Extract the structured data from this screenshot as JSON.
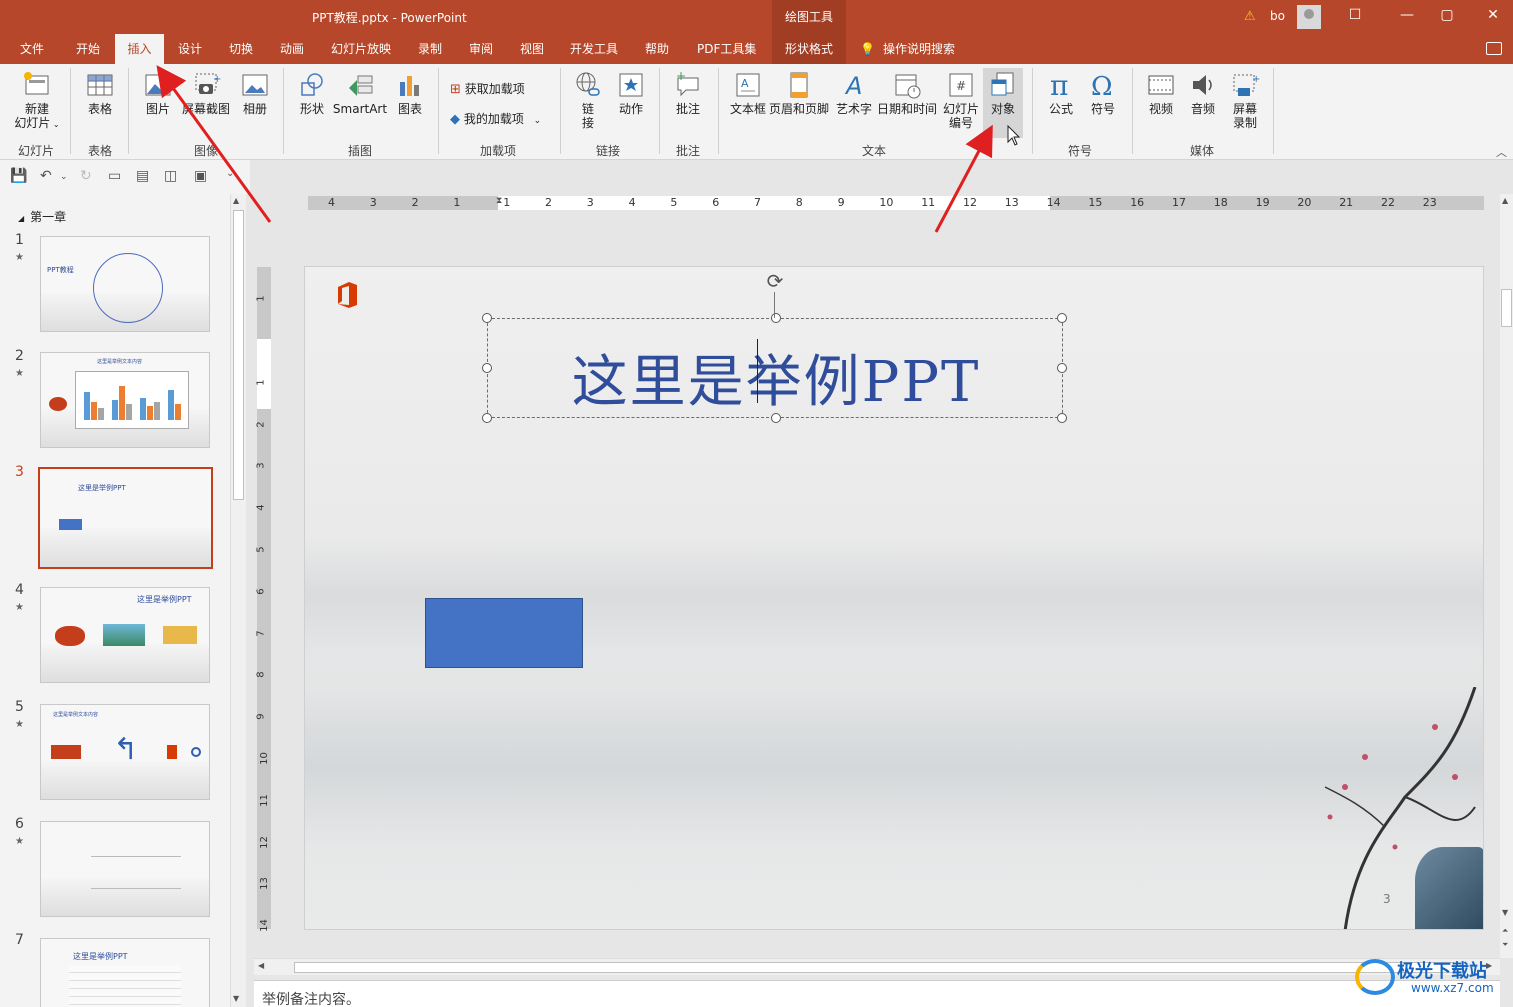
{
  "titlebar": {
    "document_title": "PPT教程.pptx  -  PowerPoint",
    "context_tool_title": "绘图工具",
    "user_name": "bo",
    "minimize": "—",
    "restore": "☐",
    "maximize": "▢",
    "close": "✕"
  },
  "tabs": [
    {
      "label": "文件"
    },
    {
      "label": "开始"
    },
    {
      "label": "插入",
      "active": true
    },
    {
      "label": "设计"
    },
    {
      "label": "切换"
    },
    {
      "label": "动画"
    },
    {
      "label": "幻灯片放映"
    },
    {
      "label": "录制"
    },
    {
      "label": "审阅"
    },
    {
      "label": "视图"
    },
    {
      "label": "开发工具"
    },
    {
      "label": "帮助"
    },
    {
      "label": "PDF工具集"
    },
    {
      "label": "形状格式"
    },
    {
      "label": "操作说明搜索"
    }
  ],
  "ribbon": {
    "new_slide": "新建\n幻灯片",
    "new_slide_line1": "新建",
    "new_slide_line2": "幻灯片",
    "table": "表格",
    "picture": "图片",
    "screenshot": "屏幕截图",
    "album": "相册",
    "shapes": "形状",
    "smartart": "SmartArt",
    "chart": "图表",
    "get_addins": "获取加载项",
    "my_addins": "我的加载项",
    "link_line1": "链",
    "link_line2": "接",
    "action": "动作",
    "comment": "批注",
    "textbox": "文本框",
    "header_footer": "页眉和页脚",
    "wordart": "艺术字",
    "datetime": "日期和时间",
    "slide_number_line1": "幻灯片",
    "slide_number_line2": "编号",
    "object": "对象",
    "equation": "公式",
    "symbol": "符号",
    "video": "视频",
    "audio": "音频",
    "screen_record_line1": "屏幕",
    "screen_record_line2": "录制",
    "groups": {
      "slides": "幻灯片",
      "tables": "表格",
      "images": "图像",
      "illustrations": "插图",
      "addins": "加载项",
      "links": "链接",
      "comments": "批注",
      "text": "文本",
      "symbols": "符号",
      "media": "媒体"
    }
  },
  "slide_pane": {
    "section": "第一章",
    "slides": [
      {
        "number": "1",
        "caption": "PPT教程"
      },
      {
        "number": "2",
        "caption": "这里是举例文本内容"
      },
      {
        "number": "3",
        "caption": "这里是举例PPT",
        "selected": true
      },
      {
        "number": "4",
        "caption": "这里是举例PPT"
      },
      {
        "number": "5",
        "caption": "这里是举例文本内容"
      },
      {
        "number": "6",
        "caption": ""
      },
      {
        "number": "7",
        "caption": "这里是举例PPT"
      }
    ]
  },
  "ruler": {
    "horizontal": [
      "4",
      "3",
      "2",
      "1",
      "1",
      "2",
      "3",
      "4",
      "5",
      "6",
      "7",
      "8",
      "9",
      "10",
      "11",
      "12",
      "13",
      "14",
      "15",
      "16",
      "17",
      "18",
      "19",
      "20",
      "21",
      "22",
      "23"
    ],
    "vertical": [
      "1",
      "1",
      "2",
      "3",
      "4",
      "5",
      "6",
      "7",
      "8",
      "9",
      "10",
      "11",
      "12",
      "13",
      "14"
    ]
  },
  "slide": {
    "title": "这里是举例PPT",
    "page_number": "3"
  },
  "notes": {
    "text": "举例备注内容。"
  },
  "watermark": {
    "name": "极光下载站",
    "url": "www.xz7.com"
  },
  "colors": {
    "accent": "#b7472a",
    "title_text": "#2f4d9b",
    "shape_fill": "#4472c4",
    "selection_border": "#c43e1c",
    "annotation_arrow": "#e02020"
  }
}
